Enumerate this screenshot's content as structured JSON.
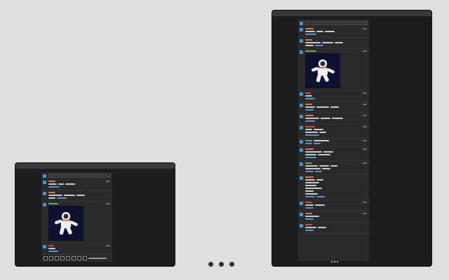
{
  "colors": {
    "page_bg": "#e0e0e0",
    "window_bg": "#1d1d1d",
    "feed_bg": "#2a2a2a",
    "accent_blue": "#4a8fd0",
    "name_orange": "#e27a3a",
    "name_red": "#d94b3b",
    "name_green": "#5db35d",
    "timestamp_green": "#3f8a4f",
    "image_bg": "#0d1130"
  },
  "icons": {
    "avatar": "avatar-square",
    "image": "astronaut-illustration",
    "more": "ellipsis-icon"
  }
}
